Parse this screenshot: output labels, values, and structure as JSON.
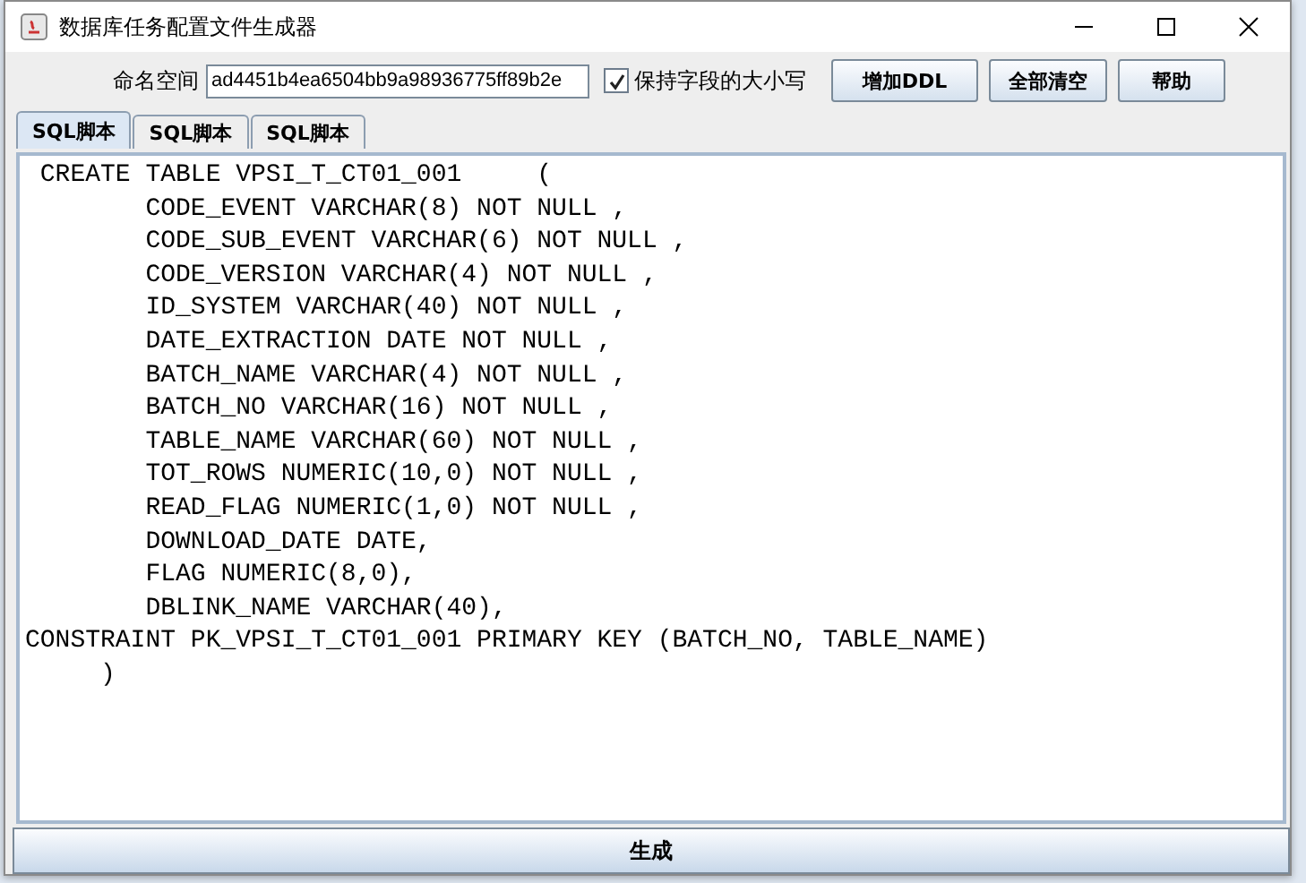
{
  "window": {
    "title": "数据库任务配置文件生成器"
  },
  "toolbar": {
    "namespace_label": "命名空间",
    "namespace_value": "ad4451b4ea6504bb9a98936775ff89b2e",
    "keep_case": {
      "label": "保持字段的大小写",
      "checked": true
    },
    "buttons": [
      "增加DDL",
      "全部清空",
      "帮助"
    ]
  },
  "tabs": [
    {
      "label": "SQL脚本",
      "selected": true
    },
    {
      "label": "SQL脚本",
      "selected": false
    },
    {
      "label": "SQL脚本",
      "selected": false
    }
  ],
  "editor": {
    "lines": [
      " CREATE TABLE VPSI_T_CT01_001     (",
      "        CODE_EVENT VARCHAR(8) NOT NULL ,",
      "        CODE_SUB_EVENT VARCHAR(6) NOT NULL ,",
      "        CODE_VERSION VARCHAR(4) NOT NULL ,",
      "        ID_SYSTEM VARCHAR(40) NOT NULL ,",
      "        DATE_EXTRACTION DATE NOT NULL ,",
      "        BATCH_NAME VARCHAR(4) NOT NULL ,",
      "        BATCH_NO VARCHAR(16) NOT NULL ,",
      "        TABLE_NAME VARCHAR(60) NOT NULL ,",
      "        TOT_ROWS NUMERIC(10,0) NOT NULL ,",
      "        READ_FLAG NUMERIC(1,0) NOT NULL ,",
      "        DOWNLOAD_DATE DATE,",
      "        FLAG NUMERIC(8,0),",
      "        DBLINK_NAME VARCHAR(40),",
      "CONSTRAINT PK_VPSI_T_CT01_001 PRIMARY KEY (BATCH_NO, TABLE_NAME)",
      "     )"
    ]
  },
  "generate_button": "生成"
}
